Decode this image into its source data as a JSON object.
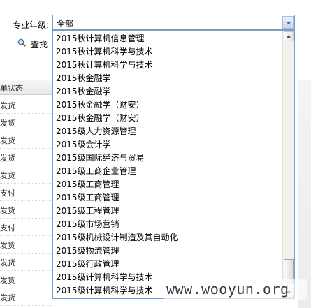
{
  "filter": {
    "grade_label": "专业年级:",
    "selected": "全部"
  },
  "search": {
    "label": "查找",
    "icon": "magnifier-icon"
  },
  "table": {
    "header": "单状态",
    "rows": [
      "发货",
      "发货",
      "发货",
      "发货",
      "发货",
      "支付",
      "发货",
      "支付",
      "发货",
      "发货",
      "发货",
      "发货"
    ]
  },
  "dropdown": {
    "items": [
      "2015秋计算机信息管理",
      "2015秋计算机科学与技术",
      "2015秋计算机科学与技术",
      "2015秋金融学",
      "2015秋金融学",
      "2015秋金融学（财安）",
      "2015秋金融学（财安）",
      "2015级人力资源管理",
      "2015级会计学",
      "2015级国际经济与贸易",
      "2015级工商企业管理",
      "2015级工商管理",
      "2015级工商管理",
      "2015级工程管理",
      "2015级市场营销",
      "2015级机械设计制造及其自动化",
      "2015级物流管理",
      "2015级行政管理",
      "2015级计算机科学与技术",
      "2015级计算机科学与技术"
    ]
  },
  "watermark": {
    "text": "www.wooyun.org"
  }
}
